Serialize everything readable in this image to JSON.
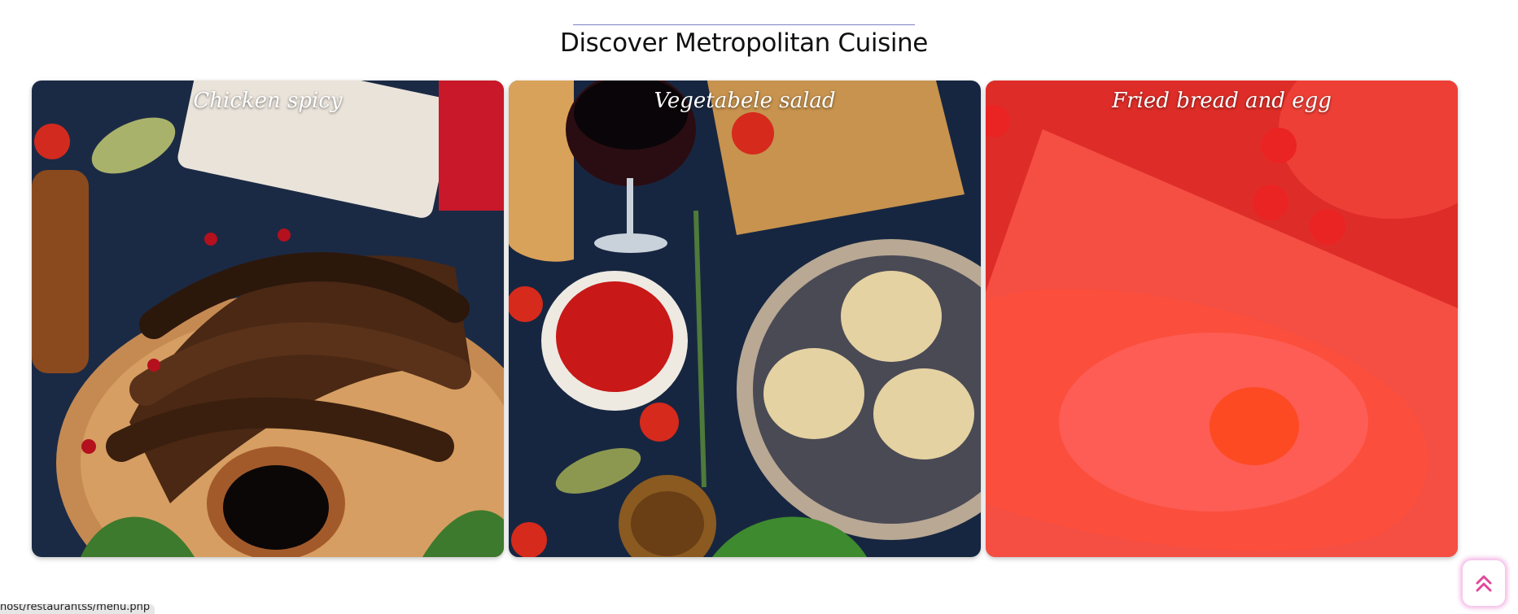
{
  "section": {
    "title": "Discover Metropolitan Cuisine"
  },
  "cards": [
    {
      "caption": "Chicken spicy"
    },
    {
      "caption": "Vegetabele salad"
    },
    {
      "caption": "Fried bread and egg"
    }
  ],
  "status_bar": {
    "url": "host/restaurantss/menu.php"
  },
  "colors": {
    "accent_overlay": "#ff2a2a",
    "scroll_glow": "#f3b7e5",
    "scroll_icon": "#e0489a"
  },
  "icons": {
    "scroll_top": "double-chevron-up-icon"
  }
}
